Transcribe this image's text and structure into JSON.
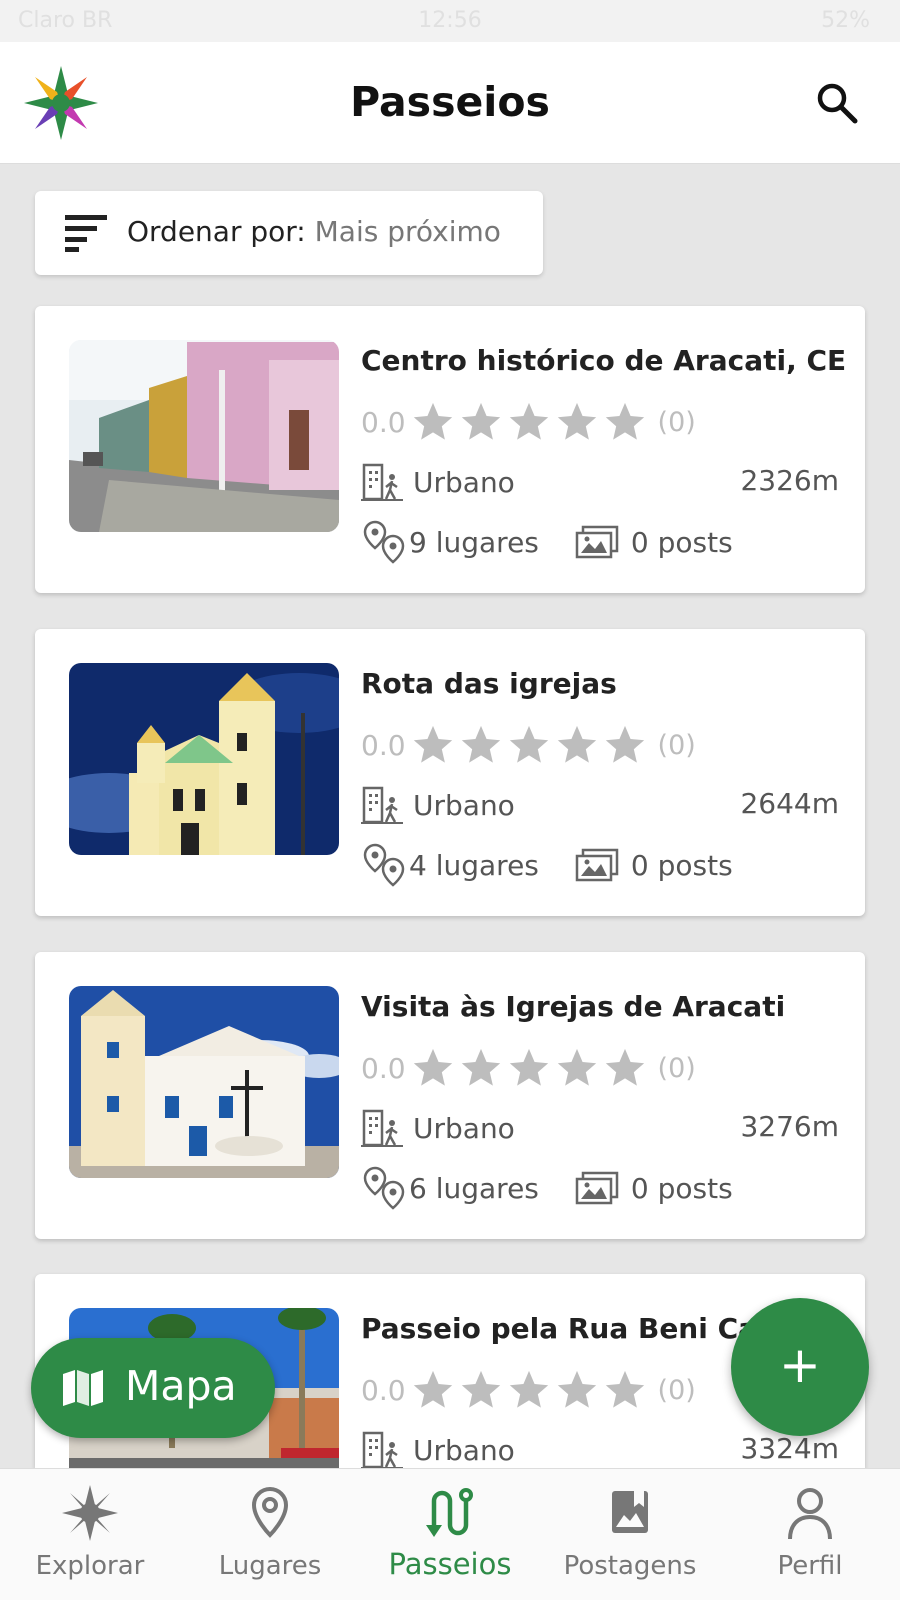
{
  "status_bar": {
    "carrier": "Claro BR",
    "time": "12:56",
    "battery": "52%"
  },
  "header": {
    "title": "Passeios",
    "logo_icon": "star-compass-logo",
    "search_icon": "search-icon"
  },
  "sort": {
    "label": "Ordenar por:",
    "value": "Mais próximo"
  },
  "tours": [
    {
      "name": "Centro histórico de Aracati, CE",
      "rating": "0.0",
      "rating_count": "(0)",
      "stars": 0,
      "category": "Urbano",
      "distance": "2326m",
      "places": "9 lugares",
      "posts": "0 posts"
    },
    {
      "name": "Rota das igrejas",
      "rating": "0.0",
      "rating_count": "(0)",
      "stars": 0,
      "category": "Urbano",
      "distance": "2644m",
      "places": "4 lugares",
      "posts": "0 posts"
    },
    {
      "name": "Visita às Igrejas de Aracati",
      "rating": "0.0",
      "rating_count": "(0)",
      "stars": 0,
      "category": "Urbano",
      "distance": "3276m",
      "places": "6 lugares",
      "posts": "0 posts"
    },
    {
      "name": "Passeio pela Rua Beni Carv",
      "rating": "0.0",
      "rating_count": "(0)",
      "stars": 0,
      "category": "Urbano",
      "distance": "3324m",
      "places": "",
      "posts": ""
    }
  ],
  "map_button": {
    "label": "Mapa"
  },
  "fab": {
    "label": "+"
  },
  "nav": [
    {
      "label": "Explorar",
      "icon": "compass-star-icon"
    },
    {
      "label": "Lugares",
      "icon": "location-pin-icon"
    },
    {
      "label": "Passeios",
      "icon": "route-icon",
      "active": true
    },
    {
      "label": "Postagens",
      "icon": "photo-book-icon"
    },
    {
      "label": "Perfil",
      "icon": "person-icon"
    }
  ],
  "colors": {
    "accent": "#2e8b47",
    "star_inactive": "#bdbdbd",
    "text_secondary": "#555555"
  }
}
